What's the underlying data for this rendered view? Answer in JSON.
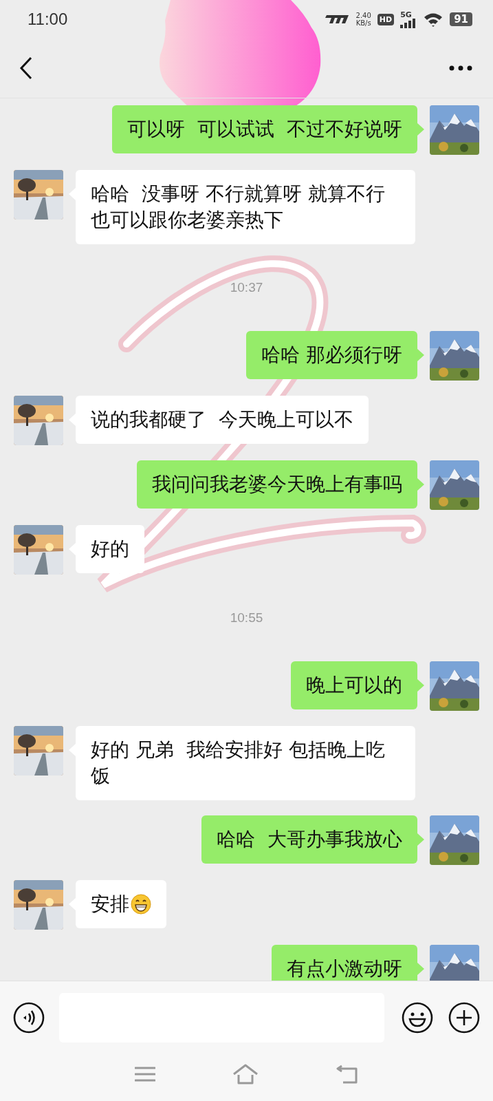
{
  "status_bar": {
    "time": "11:00",
    "speed_value": "2.40",
    "speed_unit": "KB/s",
    "hd": "HD",
    "network": "5G",
    "battery": "91"
  },
  "header": {
    "redacted": true
  },
  "messages": [
    {
      "kind": "sent",
      "text": "可以呀  可以试试  不过不好说呀"
    },
    {
      "kind": "received",
      "text": "哈哈  没事呀 不行就算呀 就算不行也可以跟你老婆亲热下"
    },
    {
      "kind": "time",
      "text": "10:37"
    },
    {
      "kind": "sent",
      "text": "哈哈 那必须行呀"
    },
    {
      "kind": "received",
      "text": "说的我都硬了  今天晚上可以不"
    },
    {
      "kind": "sent",
      "text": "我问问我老婆今天晚上有事吗"
    },
    {
      "kind": "received",
      "text": "好的"
    },
    {
      "kind": "time",
      "text": "10:55"
    },
    {
      "kind": "sent",
      "text": "晚上可以的"
    },
    {
      "kind": "received",
      "text": "好的 兄弟  我给安排好 包括晚上吃饭"
    },
    {
      "kind": "sent",
      "text": "哈哈  大哥办事我放心"
    },
    {
      "kind": "received",
      "text": "安排",
      "emoji": true
    },
    {
      "kind": "sent",
      "text": "有点小激动呀"
    }
  ],
  "scribble": {
    "kind": "digit"
  }
}
